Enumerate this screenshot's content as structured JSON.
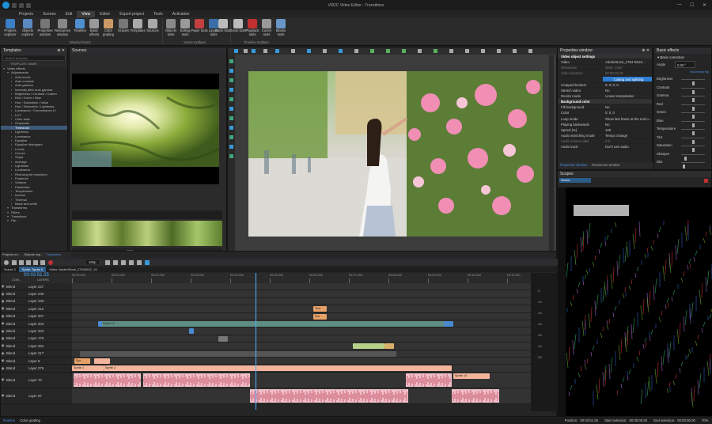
{
  "app": {
    "title": "VSDC Video Editor - Transitions"
  },
  "menu": [
    "Projects",
    "Scenes",
    "Edit",
    "View",
    "Editor",
    "Export project",
    "Tools",
    "Activation"
  ],
  "menu_active": "View",
  "ribbon": {
    "buttons": [
      "Projects explorer",
      "Objects explorer",
      "Properties window",
      "Resources window",
      "Timeline",
      "Basic effects",
      "Color grading",
      "Scopes",
      "Templates",
      "Sources",
      "Objects tools",
      "Editing tools",
      "Paper tools",
      "Layout tools",
      "Zoom tools",
      "Zoom tools",
      "Playback tools",
      "Cursor tools",
      "Blocks tools"
    ],
    "groups": [
      "Window forms",
      "Scene toolbars",
      "Timeline toolbars"
    ]
  },
  "templates_panel": {
    "title": "Templates",
    "search_placeholder": "Search template",
    "header": "TEMPLATE NAME",
    "items": [
      {
        "label": "Video effects",
        "level": 0
      },
      {
        "label": "Adjustments",
        "level": 1
      },
      {
        "label": "Auto levels",
        "level": 2
      },
      {
        "label": "Auto contrast",
        "level": 2
      },
      {
        "label": "Auto gamma",
        "level": 2
      },
      {
        "label": "Intensity after auto gamma",
        "level": 2
      },
      {
        "label": "Brightness / Contrast / Gamm",
        "level": 2
      },
      {
        "label": "Red / Green / Blue",
        "level": 2
      },
      {
        "label": "Hue / Saturation / Value",
        "level": 2
      },
      {
        "label": "Hue / Saturation / Lightness",
        "level": 2
      },
      {
        "label": "Luminance / Chrominance (Y..",
        "level": 2
      },
      {
        "label": "LUT",
        "level": 2
      },
      {
        "label": "Color twist",
        "level": 2
      },
      {
        "label": "Grayscale",
        "level": 2
      },
      {
        "label": "Threshold",
        "level": 2,
        "selected": true
      },
      {
        "label": "Lightness",
        "level": 2
      },
      {
        "label": "Luminance",
        "level": 2
      },
      {
        "label": "Equalize",
        "level": 2
      },
      {
        "label": "Equalize Histogram",
        "level": 2
      },
      {
        "label": "Levels",
        "level": 2
      },
      {
        "label": "Curves",
        "level": 2
      },
      {
        "label": "Sepia",
        "level": 2
      },
      {
        "label": "Average",
        "level": 2
      },
      {
        "label": "Lightness",
        "level": 2
      },
      {
        "label": "Luminance",
        "level": 2
      },
      {
        "label": "Reducing bit resolution",
        "level": 2
      },
      {
        "label": "Posterize",
        "level": 2
      },
      {
        "label": "Solarize",
        "level": 2
      },
      {
        "label": "Parabolize",
        "level": 2
      },
      {
        "label": "Temperature",
        "level": 2
      },
      {
        "label": "Inverse",
        "level": 2
      },
      {
        "label": "Thermal",
        "level": 2
      },
      {
        "label": "Black and white",
        "level": 2
      },
      {
        "label": "Transforms",
        "level": 1
      },
      {
        "label": "Filters",
        "level": 1
      },
      {
        "label": "Transitions",
        "level": 1
      },
      {
        "label": "Flip",
        "level": 1
      }
    ]
  },
  "sources_panel": {
    "title": "Sources",
    "source_label": "Source"
  },
  "properties_panel": {
    "title": "Properties window",
    "rows": [
      {
        "k": "Video object settings",
        "v": "",
        "type": "hdr"
      },
      {
        "k": "Video",
        "v": "AdobeStock_2784 NS22..."
      },
      {
        "k": "Resolution",
        "v": "3840, 2160",
        "type": "dim"
      },
      {
        "k": "Video duration",
        "v": "00:00:15.15",
        "type": "dim"
      },
      {
        "k": "",
        "v": "Cutting and splitting",
        "type": "btn"
      },
      {
        "k": "Cropped borders",
        "v": "0; 0; 0; 0"
      },
      {
        "k": "Stretch video",
        "v": "No"
      },
      {
        "k": "Resize mode",
        "v": "Linear interpolation"
      },
      {
        "k": "Background color",
        "v": "",
        "type": "hdr"
      },
      {
        "k": "Fill background",
        "v": "No"
      },
      {
        "k": "Color",
        "v": "0; 0; 0"
      },
      {
        "k": "Loop mode",
        "v": "Show last frame at the end o..."
      },
      {
        "k": "Playing backwards",
        "v": "No"
      },
      {
        "k": "Speed (%)",
        "v": "100"
      },
      {
        "k": "Audio stretching mode",
        "v": "Tempo change"
      },
      {
        "k": "Audio volume (dB)",
        "v": "0.0",
        "type": "dim"
      },
      {
        "k": "Audio track",
        "v": "Don't use audio"
      }
    ],
    "tabs": [
      "Properties window",
      "Resources window"
    ]
  },
  "basic_effects": {
    "title": "Basic effects",
    "section": "Basic correction",
    "angle_label": "Angle",
    "angle_value": "0.00 °",
    "horizontal_flip": "Horizontal flip",
    "sliders": [
      {
        "label": "Brightness",
        "value": 0.5
      },
      {
        "label": "Contrast",
        "value": 0.5
      },
      {
        "label": "Gamma",
        "value": 0.5
      },
      {
        "label": "Red",
        "value": 0.5
      },
      {
        "label": "Green",
        "value": 0.5
      },
      {
        "label": "Blue",
        "value": 0.5
      },
      {
        "label": "Temperature",
        "value": 0.5
      },
      {
        "label": "Tint",
        "value": 0.5
      },
      {
        "label": "Saturation",
        "value": 0.5
      },
      {
        "label": "Sharpen",
        "value": 0.15
      },
      {
        "label": "Blur",
        "value": 0.1
      }
    ]
  },
  "scopes": {
    "title": "Scopes",
    "mode": "Scene"
  },
  "timeline": {
    "left_tabs": [
      "Projects ex...",
      "Objects exp...",
      "Templates"
    ],
    "zoom": "480p",
    "breadcrumb": [
      "Scene 0",
      "Sprite: Sprite 5",
      "Video: AdobeStock_27945522_15"
    ],
    "timecode": "00:02:51.25",
    "col_com": "COM...",
    "col_layers": "LAYERS",
    "ruler": [
      "00:00.000",
      "00:01.000",
      "00:02.000",
      "00:03.000",
      "00:04.000",
      "00:05.000",
      "00:06.000",
      "00:07.000",
      "00:08.000",
      "00:09.000",
      "00:10.000",
      "00:11.000"
    ],
    "tracks": [
      {
        "blend": "Blend",
        "layer": "Layer 247"
      },
      {
        "blend": "Blend",
        "layer": "Layer 246"
      },
      {
        "blend": "Blend",
        "layer": "Layer 245"
      },
      {
        "blend": "Blend",
        "layer": "Layer 212"
      },
      {
        "blend": "Blend",
        "layer": "Layer 207"
      },
      {
        "blend": "Blend",
        "layer": "Layer 204"
      },
      {
        "blend": "Blend",
        "layer": "Layer 203"
      },
      {
        "blend": "Blend",
        "layer": "Layer 176"
      },
      {
        "blend": "Blend",
        "layer": "Layer 262"
      },
      {
        "blend": "Blend",
        "layer": "Layer 217"
      },
      {
        "blend": "Blend",
        "layer": "Layer 8"
      },
      {
        "blend": "Blend",
        "layer": "Layer 275"
      },
      {
        "blend": "Blend",
        "layer": "Layer 70"
      },
      {
        "blend": "Blend",
        "layer": "Layer 87"
      }
    ],
    "clip_labels": {
      "text1": "Text",
      "file": "File",
      "scale": "Scale 13",
      "sprite2": "Sprite 2",
      "sprite14": "Sprite 14",
      "sprite1": "Sprite 1",
      "spr": "Spr..."
    },
    "db_labels": [
      "-5",
      "-10",
      "-15",
      "-20",
      "-30",
      "-40",
      "-50"
    ]
  },
  "bottom_tabs": [
    "Timeline",
    "Color grading"
  ],
  "status": {
    "position_label": "Position:",
    "position": "00:02:51.25",
    "start_label": "Start selection:",
    "start": "00:00:00.00",
    "end_label": "End selection:",
    "end": "00:00:00.00",
    "zoom": "70%"
  },
  "colors": {
    "accent": "#2d7ed4",
    "selection": "#3d5a78",
    "text_clip": "#e8a268",
    "sprite_clip": "#f2b49a",
    "scale_clip": "#5f8f84",
    "audio_clip": "#f0c0c8"
  }
}
